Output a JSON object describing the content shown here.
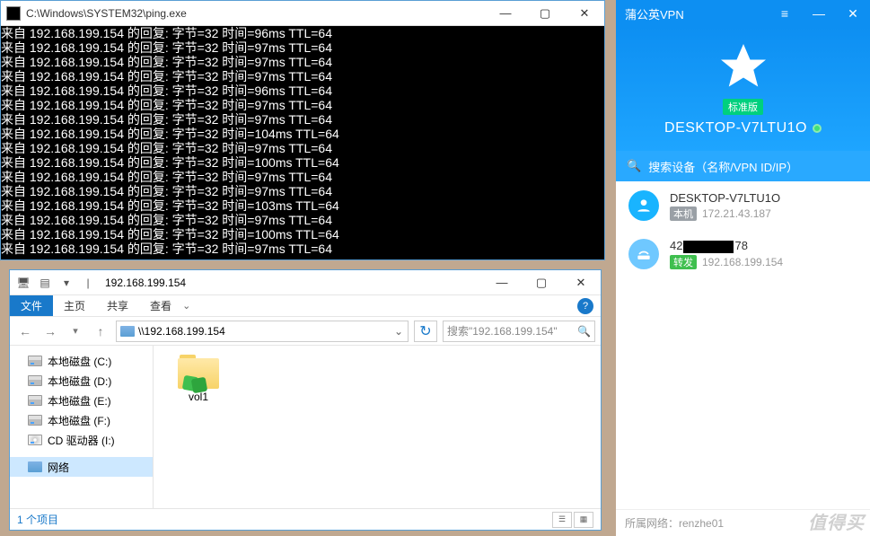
{
  "cmd": {
    "title": "C:\\Windows\\SYSTEM32\\ping.exe",
    "ip": "192.168.199.154",
    "prefix": "来自 ",
    "reply": " 的回复: 字节=32 时间=",
    "ttl": " TTL=64",
    "times": [
      "96ms",
      "97ms",
      "97ms",
      "97ms",
      "96ms",
      "97ms",
      "97ms",
      "104ms",
      "97ms",
      "100ms",
      "97ms",
      "97ms",
      "103ms",
      "97ms",
      "100ms",
      "97ms"
    ]
  },
  "explorer": {
    "title": "192.168.199.154",
    "tabs": {
      "file": "文件",
      "home": "主页",
      "share": "共享",
      "view": "查看"
    },
    "address": "\\\\192.168.199.154",
    "search_placeholder": "搜索\"192.168.199.154\"",
    "tree": [
      {
        "label": "本地磁盘 (C:)",
        "type": "disk"
      },
      {
        "label": "本地磁盘 (D:)",
        "type": "disk"
      },
      {
        "label": "本地磁盘 (E:)",
        "type": "disk"
      },
      {
        "label": "本地磁盘 (F:)",
        "type": "disk"
      },
      {
        "label": "CD 驱动器 (I:)",
        "type": "cd"
      },
      {
        "label": "网络",
        "type": "net",
        "sel": true
      }
    ],
    "item": {
      "name": "vol1"
    },
    "status": "1 个项目"
  },
  "vpn": {
    "title": "蒲公英VPN",
    "badge": "标准版",
    "hostname": "DESKTOP-V7LTU1O",
    "search_placeholder": "搜索设备（名称/VPN ID/IP）",
    "devices": [
      {
        "name": "DESKTOP-V7LTU1O",
        "tag": "本机",
        "tagClass": "local",
        "ip": "172.21.43.187",
        "type": "pc"
      },
      {
        "name_a": "42",
        "name_b": "78",
        "tag": "转发",
        "tagClass": "fwd",
        "ip": "192.168.199.154",
        "type": "rt"
      }
    ],
    "footer_label": "所属网络：",
    "footer_net": "renzhe01",
    "watermark": "值得买"
  }
}
